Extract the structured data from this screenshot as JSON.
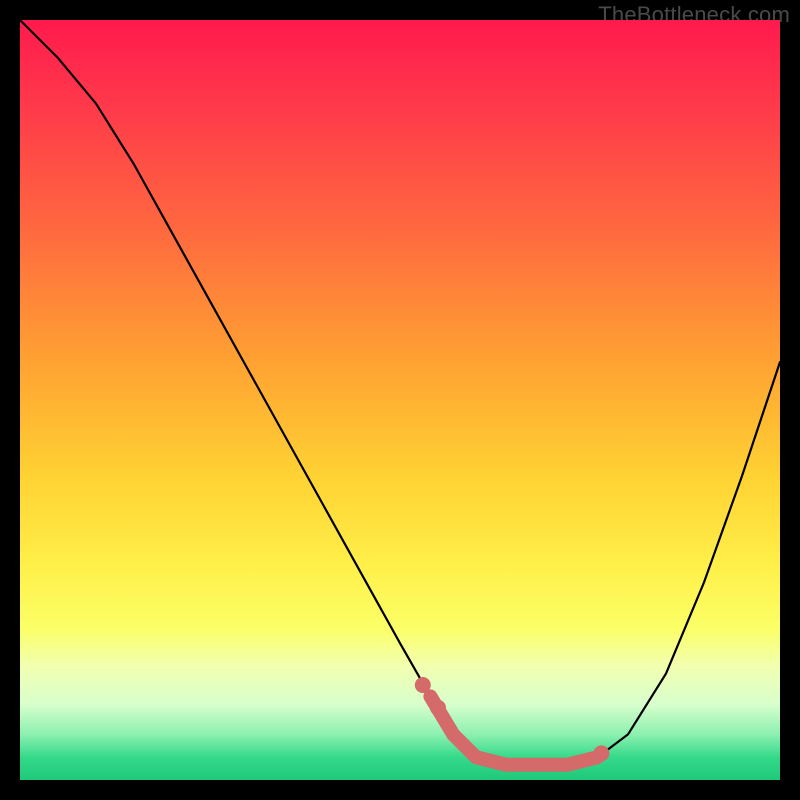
{
  "watermark": {
    "text": "TheBottleneck.com"
  },
  "colors": {
    "frame": "#000000",
    "curve_stroke": "#000000",
    "highlight_stroke": "#d46a6a",
    "highlight_dot": "#d46a6a",
    "gradient_top": "#ff1a4d",
    "gradient_bottom": "#1fc97a"
  },
  "chart_data": {
    "type": "line",
    "title": "",
    "xlabel": "",
    "ylabel": "",
    "xlim": [
      0,
      100
    ],
    "ylim": [
      0,
      100
    ],
    "grid": false,
    "note": "Zero axis labels visible; values estimated from pixel positions on a 0–100 normalized scale. Lower y means closer to optimal (green); higher y means bottleneck (red).",
    "series": [
      {
        "name": "bottleneck-curve",
        "x": [
          0,
          5,
          10,
          15,
          20,
          25,
          30,
          35,
          40,
          45,
          50,
          54,
          57,
          60,
          64,
          68,
          72,
          76,
          80,
          85,
          90,
          95,
          100
        ],
        "y": [
          100,
          95,
          89,
          81,
          72,
          63,
          54,
          45,
          36,
          27,
          18,
          11,
          6,
          3,
          2,
          2,
          2,
          3,
          6,
          14,
          26,
          40,
          55
        ]
      }
    ],
    "highlight": {
      "name": "optimal-band",
      "x": [
        54,
        57,
        60,
        64,
        68,
        72,
        76
      ],
      "y": [
        11,
        6,
        3,
        2,
        2,
        2,
        3
      ]
    },
    "highlight_dots": {
      "x": [
        53,
        55,
        76.5
      ],
      "y": [
        12.5,
        9.5,
        3.5
      ]
    }
  }
}
